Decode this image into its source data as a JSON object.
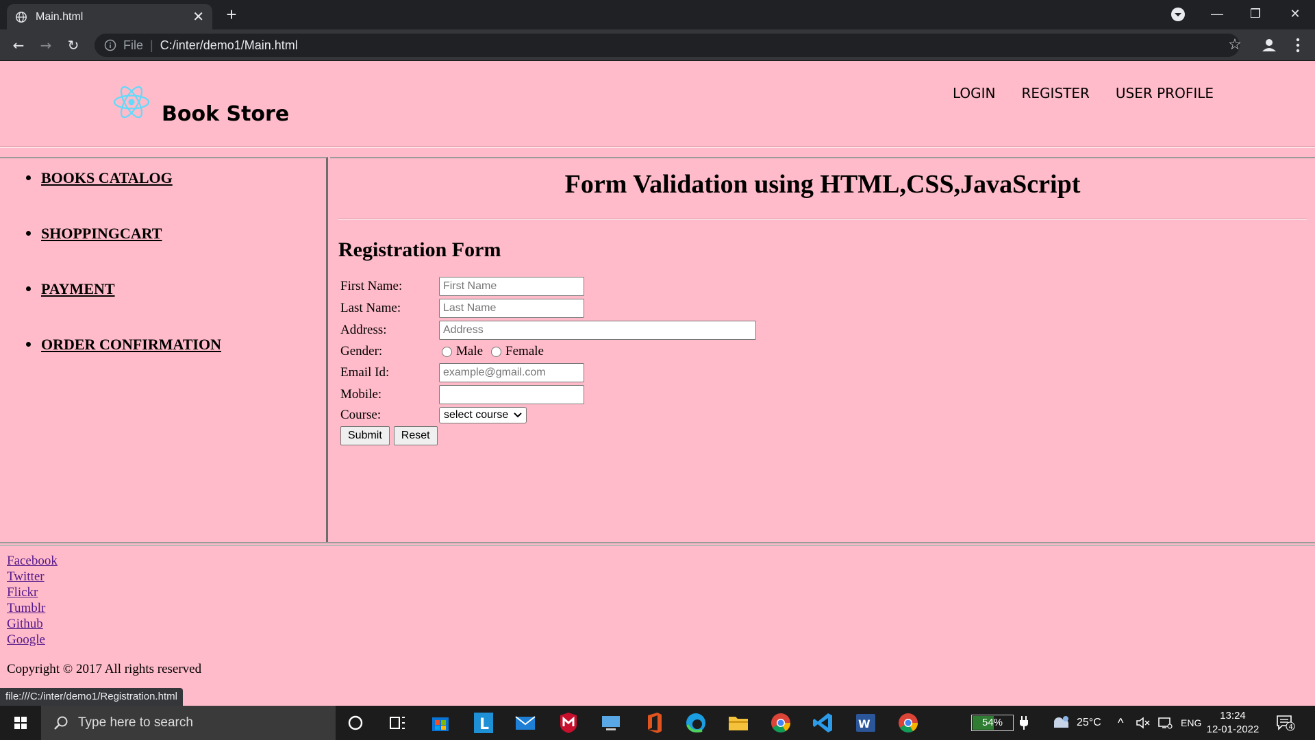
{
  "browser": {
    "tab_title": "Main.html",
    "tab_close": "✕",
    "new_tab": "+",
    "address_scheme": "File",
    "address_path": "C:/inter/demo1/Main.html",
    "status_url": "file:///C:/inter/demo1/Registration.html",
    "minimize": "—",
    "restore": "❐",
    "close": "✕"
  },
  "header": {
    "brand": "Book Store",
    "nav": [
      "LOGIN",
      "REGISTER",
      "USER PROFILE"
    ]
  },
  "sidebar": {
    "items": [
      "BOOKS CATALOG",
      "SHOPPINGCART",
      "PAYMENT",
      "ORDER CONFIRMATION"
    ]
  },
  "main": {
    "title": "Form Validation using HTML,CSS,JavaScript",
    "form_title": "Registration Form",
    "fields": {
      "first_name_label": "First Name:",
      "first_name_placeholder": "First Name",
      "last_name_label": "Last Name:",
      "last_name_placeholder": "Last Name",
      "address_label": "Address:",
      "address_placeholder": "Address",
      "gender_label": "Gender:",
      "gender_male": "Male",
      "gender_female": "Female",
      "email_label": "Email Id:",
      "email_placeholder": "example@gmail.com",
      "mobile_label": "Mobile:",
      "course_label": "Course:",
      "course_selected": "select course"
    },
    "submit": "Submit",
    "reset": "Reset"
  },
  "footer": {
    "links": [
      "Facebook",
      "Twitter",
      "Flickr",
      "Tumblr",
      "Github",
      "Google"
    ],
    "copyright": "Copyright © 2017 All rights reserved"
  },
  "taskbar": {
    "search_placeholder": "Type here to search",
    "battery": "54%",
    "battery_level": 0.54,
    "weather": "25°C",
    "language": "ENG",
    "time": "13:24",
    "date": "12-01-2022",
    "notifications": "4"
  }
}
